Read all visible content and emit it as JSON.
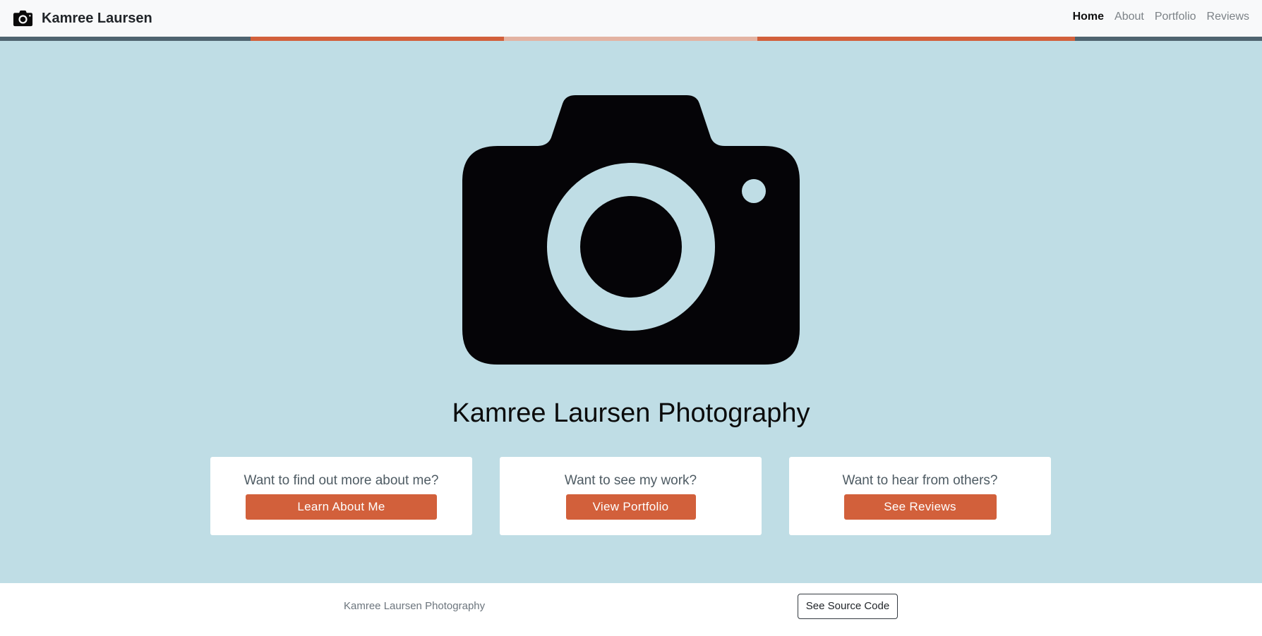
{
  "navbar": {
    "brand_icon": "camera-icon",
    "brand": "Kamree Laursen",
    "links": [
      {
        "label": "Home",
        "active": true
      },
      {
        "label": "About",
        "active": false
      },
      {
        "label": "Portfolio",
        "active": false
      },
      {
        "label": "Reviews",
        "active": false
      }
    ]
  },
  "colors": {
    "navbar_bg": "#f8f9fa",
    "hero_bg": "#bfdde5",
    "accent": "#d2603b",
    "stripe": [
      "#4f6470",
      "#d2603b",
      "#e3b3a2",
      "#d2603b",
      "#4f6470"
    ]
  },
  "hero": {
    "icon": "camera-icon",
    "title": "Kamree Laursen Photography"
  },
  "cards": [
    {
      "prompt": "Want to find out more about me?",
      "button": "Learn About Me"
    },
    {
      "prompt": "Want to see my work?",
      "button": "View Portfolio"
    },
    {
      "prompt": "Want to hear from others?",
      "button": "See Reviews"
    }
  ],
  "footer": {
    "text": "Kamree Laursen Photography",
    "button": "See Source Code"
  }
}
